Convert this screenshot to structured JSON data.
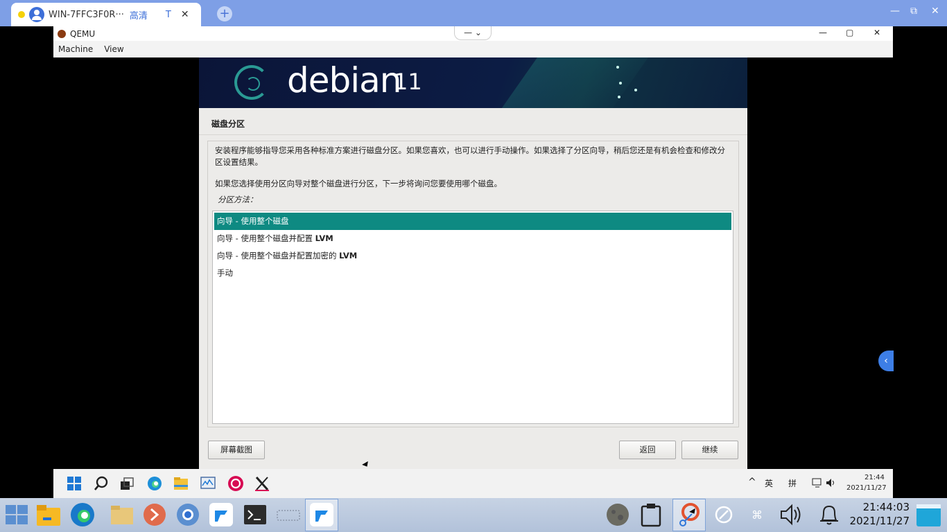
{
  "browser": {
    "tab_title": "WIN-7FFC3F0R···",
    "tab_quality": "高清",
    "tab_mark": "T",
    "tab_close": "✕",
    "new_tab": "+",
    "controls": [
      "—",
      "⧉",
      "✕"
    ]
  },
  "qemu": {
    "title": "QEMU",
    "dropper": "— ⌄",
    "window_controls": [
      "—",
      "▢",
      "✕"
    ],
    "menu": [
      "Machine",
      "View"
    ]
  },
  "installer": {
    "banner_text": "debian",
    "banner_version": "11",
    "page_title": "磁盘分区",
    "paragraph1": "安装程序能够指导您采用各种标准方案进行磁盘分区。如果您喜欢，也可以进行手动操作。如果选择了分区向导，稍后您还是有机会检查和修改分区设置结果。",
    "paragraph2": "如果您选择使用分区向导对整个磁盘进行分区，下一步将询问您要使用哪个磁盘。",
    "method_label": "分区方法：",
    "options": [
      {
        "prefix": "向导 - 使用整个磁盘",
        "suffix": ""
      },
      {
        "prefix": "向导 - 使用整个磁盘并配置 ",
        "suffix": "LVM"
      },
      {
        "prefix": "向导 - 使用整个磁盘并配置加密的 ",
        "suffix": "LVM"
      },
      {
        "prefix": "手动",
        "suffix": ""
      }
    ],
    "selected_index": 0,
    "buttons": {
      "screenshot": "屏幕截图",
      "back": "返回",
      "continue": "继续"
    },
    "accent_color": "#0e8a82"
  },
  "guest_taskbar": {
    "icons": [
      "windows-start-icon",
      "search-icon",
      "task-view-icon",
      "edge-icon",
      "file-explorer-icon",
      "monitor-icon",
      "debian-icon",
      "xming-icon"
    ],
    "tray": {
      "chevron": "^",
      "lang": "英",
      "ime": "拼",
      "time": "21:44",
      "date": "2021/11/27"
    }
  },
  "side_button": "‹",
  "host_taskbar": {
    "icons": [
      "start-icon",
      "folder-icon",
      "edge-icon",
      "files-icon",
      "remote-icon",
      "chrome-icon",
      "app-icon",
      "terminal-icon",
      "keyboard-icon",
      "todesk-icon",
      "moon-icon",
      "clipboard-icon",
      "screenshot-tool-icon",
      "sync-icon",
      "command-icon",
      "volume-icon",
      "bell-icon",
      "desktop-icon"
    ],
    "time": "21:44:03",
    "date": "2021/11/27"
  }
}
